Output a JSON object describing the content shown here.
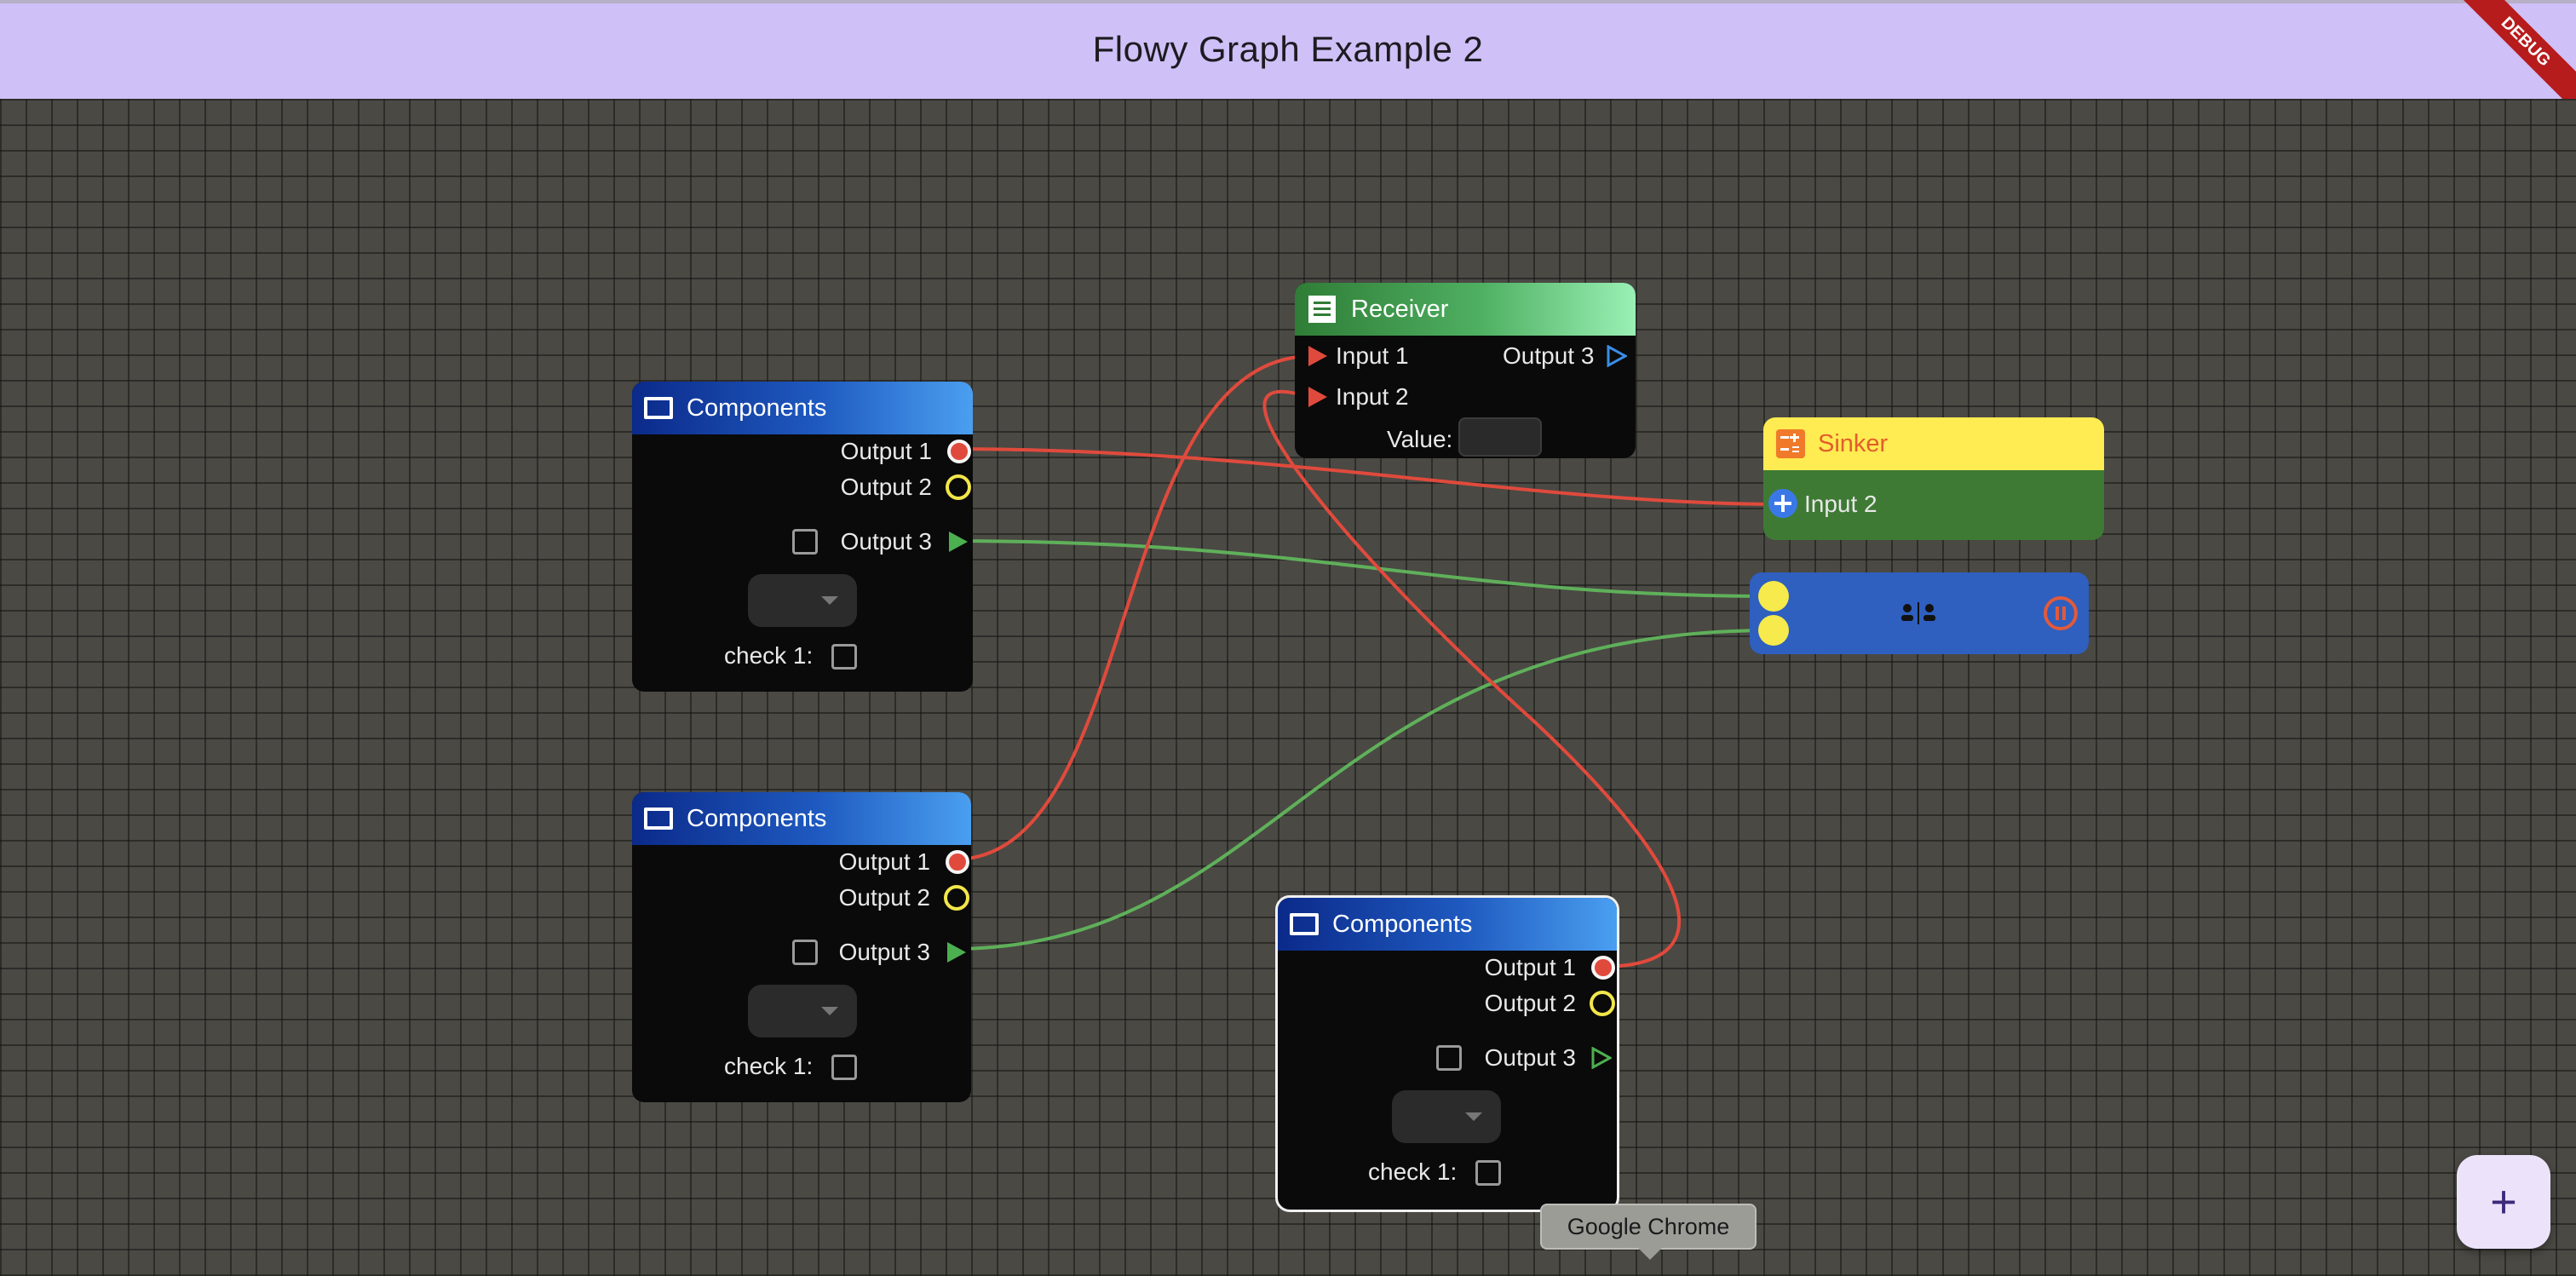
{
  "app": {
    "title": "Flowy Graph Example 2",
    "debug_banner": "DEBUG"
  },
  "colors": {
    "appbar": "#cfc0f8",
    "canvas": "#4a4944",
    "edge_red": "#e04a3c",
    "edge_green": "#5fb05a",
    "node_bg": "#0a0a0a",
    "accent_blue": "#2f5fbf"
  },
  "components_nodes": [
    {
      "title": "Components",
      "icon": "window-icon",
      "outputs": [
        "Output 1",
        "Output 2",
        "Output 3"
      ],
      "dropdown_value": "",
      "check_label": "check 1:",
      "check_value": false,
      "output3_checked": false
    },
    {
      "title": "Components",
      "icon": "window-icon",
      "outputs": [
        "Output 1",
        "Output 2",
        "Output 3"
      ],
      "dropdown_value": "",
      "check_label": "check 1:",
      "check_value": false,
      "output3_checked": false
    },
    {
      "title": "Components",
      "icon": "window-icon",
      "outputs": [
        "Output 1",
        "Output 2",
        "Output 3"
      ],
      "dropdown_value": "",
      "check_label": "check 1:",
      "check_value": false,
      "output3_checked": false
    }
  ],
  "receiver": {
    "title": "Receiver",
    "icon": "receipt-icon",
    "inputs": [
      "Input 1",
      "Input 2"
    ],
    "outputs": [
      "Output 3"
    ],
    "value_label": "Value:",
    "value": ""
  },
  "sinker": {
    "title": "Sinker",
    "icon": "calculator-icon",
    "inputs": [
      "Input 2"
    ]
  },
  "control_node": {
    "icons": [
      "split-users-icon",
      "pause-circle-icon"
    ]
  },
  "fab": {
    "label": "+"
  },
  "tooltip": {
    "text": "Google Chrome"
  }
}
